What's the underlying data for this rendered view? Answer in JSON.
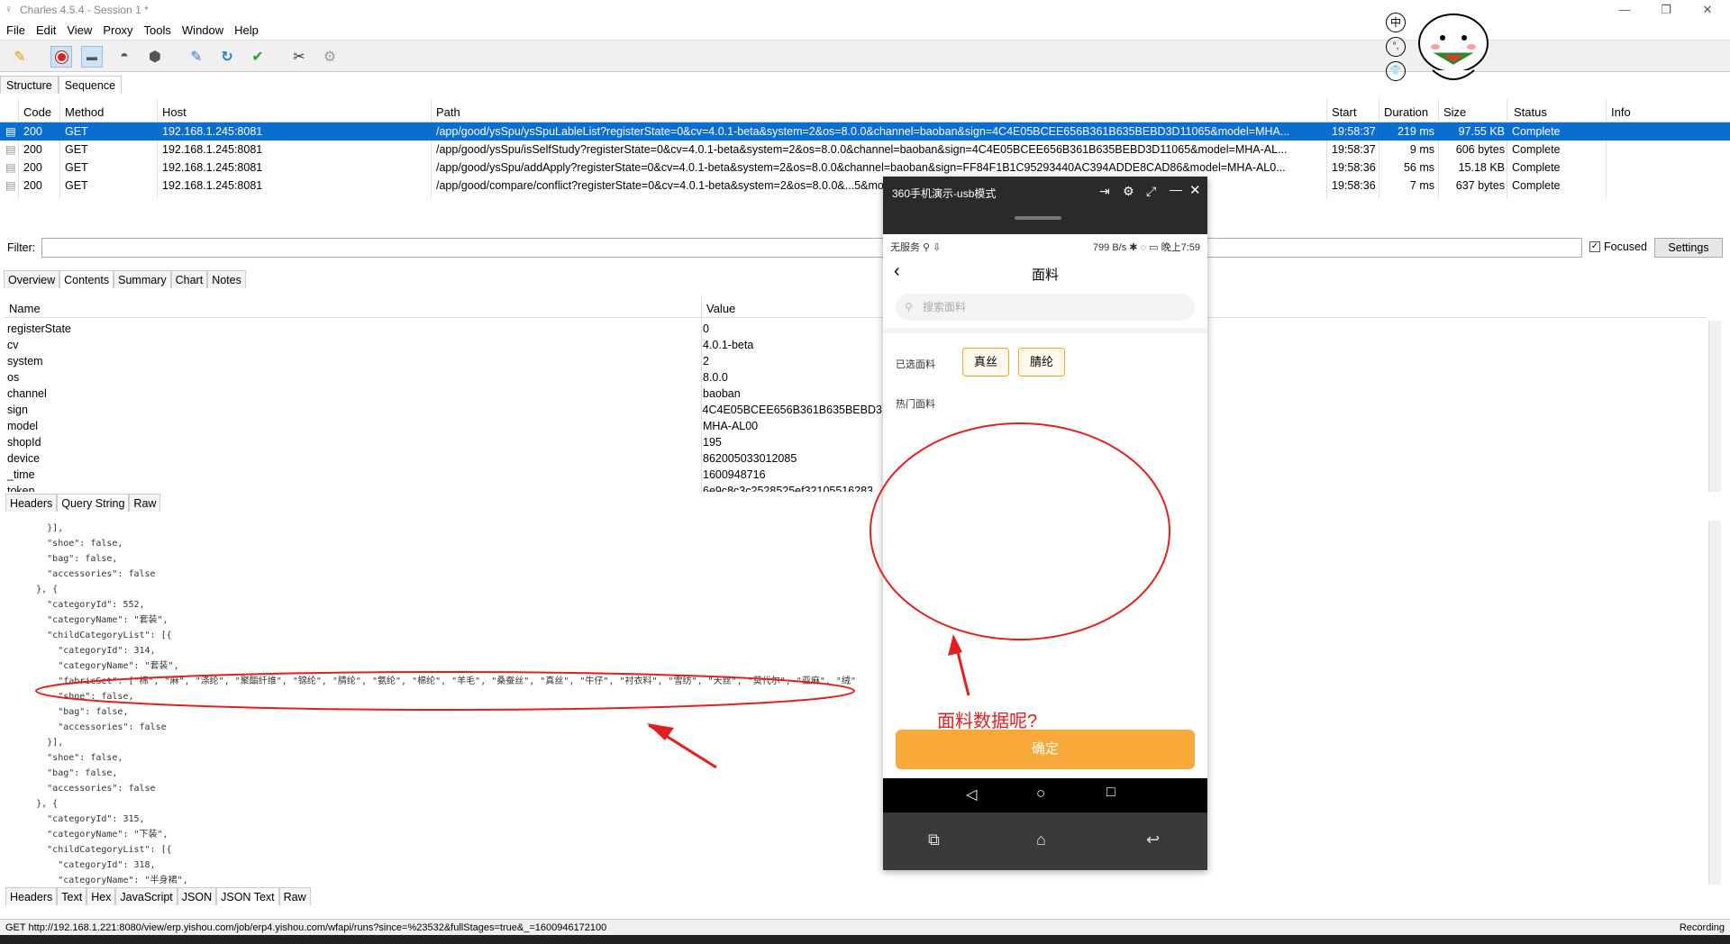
{
  "window": {
    "title": "Charles 4.5.4 - Session 1 *"
  },
  "menu": [
    "File",
    "Edit",
    "View",
    "Proxy",
    "Tools",
    "Window",
    "Help"
  ],
  "toolbar_icons": [
    "broom-icon",
    "record-icon",
    "throttle-icon",
    "turtle-icon",
    "stop-icon",
    "pen-icon",
    "refresh-icon",
    "check-icon",
    "tools-icon",
    "settings-icon"
  ],
  "top_tabs": [
    "Structure",
    "Sequence"
  ],
  "table": {
    "headers": [
      "Code",
      "Method",
      "Host",
      "Path",
      "Start",
      "Duration",
      "Size",
      "Status",
      "Info"
    ],
    "rows": [
      {
        "code": "200",
        "method": "GET",
        "host": "192.168.1.245:8081",
        "path": "/app/good/ysSpu/ysSpuLableList?registerState=0&cv=4.0.1-beta&system=2&os=8.0.0&channel=baoban&sign=4C4E05BCEE656B361B635BEBD3D11065&model=MHA...",
        "start": "19:58:37",
        "duration": "219 ms",
        "size": "97.55 KB",
        "status": "Complete"
      },
      {
        "code": "200",
        "method": "GET",
        "host": "192.168.1.245:8081",
        "path": "/app/good/ysSpu/isSelfStudy?registerState=0&cv=4.0.1-beta&system=2&os=8.0.0&channel=baoban&sign=4C4E05BCEE656B361B635BEBD3D11065&model=MHA-AL...",
        "start": "19:58:37",
        "duration": "9 ms",
        "size": "606 bytes",
        "status": "Complete"
      },
      {
        "code": "200",
        "method": "GET",
        "host": "192.168.1.245:8081",
        "path": "/app/good/ysSpu/addApply?registerState=0&cv=4.0.1-beta&system=2&os=8.0.0&channel=baoban&sign=FF84F1B1C95293440AC394ADDE8CAD86&model=MHA-AL0...",
        "start": "19:58:36",
        "duration": "56 ms",
        "size": "15.18 KB",
        "status": "Complete"
      },
      {
        "code": "200",
        "method": "GET",
        "host": "192.168.1.245:8081",
        "path": "/app/good/compare/conflict?registerState=0&cv=4.0.1-beta&system=2&os=8.0.0&...5&model=MHA-AL0...",
        "start": "19:58:36",
        "duration": "7 ms",
        "size": "637 bytes",
        "status": "Complete"
      }
    ]
  },
  "filter": {
    "label": "Filter:",
    "focused": "Focused",
    "settings": "Settings"
  },
  "detail_tabs": [
    "Overview",
    "Contents",
    "Summary",
    "Chart",
    "Notes"
  ],
  "kv": {
    "name_header": "Name",
    "value_header": "Value",
    "rows": [
      [
        "registerState",
        "0"
      ],
      [
        "cv",
        "4.0.1-beta"
      ],
      [
        "system",
        "2"
      ],
      [
        "os",
        "8.0.0"
      ],
      [
        "channel",
        "baoban"
      ],
      [
        "sign",
        "4C4E05BCEE656B361B635BEBD3D"
      ],
      [
        "model",
        "MHA-AL00"
      ],
      [
        "shopId",
        "195"
      ],
      [
        "device",
        "862005033012085"
      ],
      [
        "_time",
        "1600948716"
      ],
      [
        "token",
        "6e9c8c3c2528525ef32105516283"
      ]
    ]
  },
  "req_tabs": [
    "Headers",
    "Query String",
    "Raw"
  ],
  "resp_tabs": [
    "Headers",
    "Text",
    "Hex",
    "JavaScript",
    "JSON",
    "JSON Text",
    "Raw"
  ],
  "code_lines": [
    "        }],",
    "        \"shoe\": false,",
    "        \"bag\": false,",
    "        \"accessories\": false",
    "      }, {",
    "        \"categoryId\": 552,",
    "        \"categoryName\": \"套装\",",
    "        \"childCategoryList\": [{",
    "          \"categoryId\": 314,",
    "          \"categoryName\": \"套装\",",
    "          \"fabricSet\": [\"棉\", \"麻\", \"涤纶\", \"聚酯纤维\", \"锦纶\", \"腈纶\", \"氨纶\", \"棉纶\", \"羊毛\", \"桑蚕丝\", \"真丝\", \"牛仔\", \"衬衣料\", \"雪纺\", \"天丝\", \"莫代尔\", \"亚麻\", \"绒\"",
    "          \"shoe\": false,",
    "          \"bag\": false,",
    "          \"accessories\": false",
    "        }],",
    "        \"shoe\": false,",
    "        \"bag\": false,",
    "        \"accessories\": false",
    "      }, {",
    "        \"categoryId\": 315,",
    "        \"categoryName\": \"下装\",",
    "        \"childCategoryList\": [{",
    "          \"categoryId\": 318,",
    "          \"categoryName\": \"半身裙\","
  ],
  "statusbar": {
    "url": "GET http://192.168.1.221:8080/view/erp.yishou.com/job/erp4.yishou.com/wfapi/runs?since=%23532&fullStages=true&_=1600946172100",
    "recording": "Recording"
  },
  "phone": {
    "window_title": "360手机演示-usb模式",
    "status_left": "无服务 ⚲ ⇩",
    "status_right": "799 B/s ✱ ◌ ▭ 晚上7:59",
    "page_title": "面料",
    "search_placeholder": "搜索面料",
    "selected_label": "已选面料",
    "selected": [
      "真丝",
      "腈纶"
    ],
    "hot_label": "热门面料",
    "confirm": "确定"
  },
  "annotation": {
    "question": "面料数据呢?"
  },
  "sticker_chars": [
    "中",
    "°,",
    "👕"
  ]
}
